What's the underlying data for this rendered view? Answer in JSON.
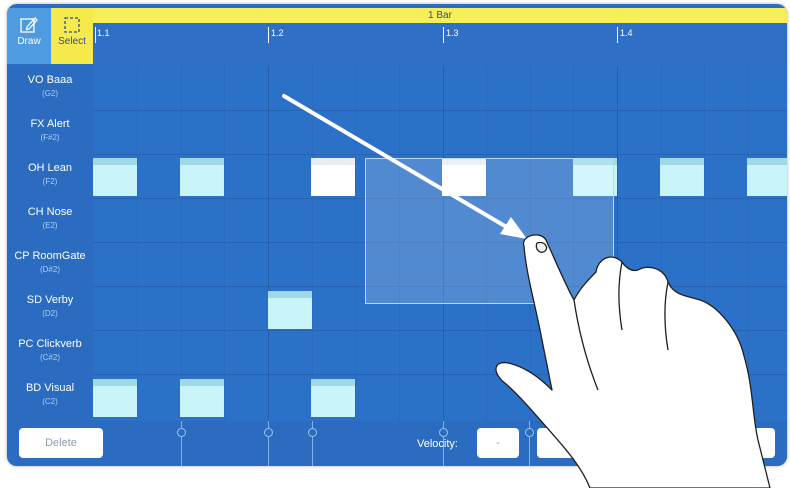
{
  "toolbar": {
    "draw_label": "Draw",
    "select_label": "Select",
    "draw_icon": "pencil-icon",
    "select_icon": "marquee-select-icon",
    "select_color": "#f6e94c"
  },
  "ruler": {
    "title": "1 Bar",
    "ticks": [
      "1.1",
      "1.2",
      "1.3",
      "1.4"
    ]
  },
  "rows": [
    {
      "name": "VO Baaa",
      "note": "(G2)"
    },
    {
      "name": "FX Alert",
      "note": "(F#2)"
    },
    {
      "name": "OH Lean",
      "note": "(F2)"
    },
    {
      "name": "CH Nose",
      "note": "(E2)"
    },
    {
      "name": "CP RoomGate",
      "note": "(D#2)"
    },
    {
      "name": "SD Verby",
      "note": "(D2)"
    },
    {
      "name": "PC Clickverb",
      "note": "(C#2)"
    },
    {
      "name": "BD Visual",
      "note": "(C2)"
    }
  ],
  "bottom": {
    "delete_label": "Delete",
    "velocity_label": "Velocity:",
    "minus_label": "-"
  },
  "colors": {
    "grid": "#2c71c8",
    "note": "#c9f4fa",
    "selected_note": "#ffffff",
    "ruler_bar": "#f7ef5a"
  }
}
